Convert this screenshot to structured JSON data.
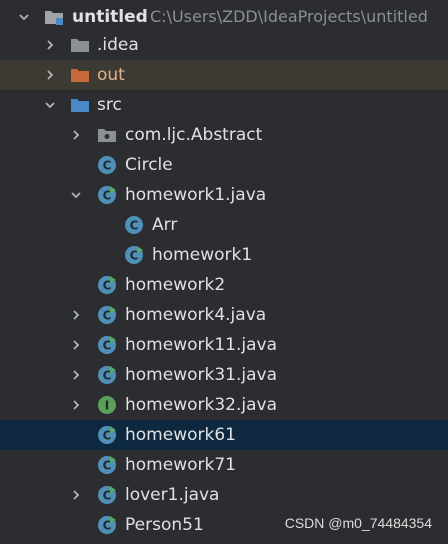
{
  "project": {
    "name": "untitled",
    "path": "C:\\Users\\ZDD\\IdeaProjects\\untitled"
  },
  "items": [
    {
      "label": ".idea",
      "icon": "folder-icon"
    },
    {
      "label": "out",
      "icon": "folder-orange-icon"
    },
    {
      "label": "src",
      "icon": "folder-blue-icon"
    },
    {
      "label": "com.ljc.Abstract",
      "icon": "package-icon"
    },
    {
      "label": "Circle",
      "icon": "class-icon"
    },
    {
      "label": "homework1.java",
      "icon": "class-runnable-icon"
    },
    {
      "label": "Arr",
      "icon": "class-icon"
    },
    {
      "label": "homework1",
      "icon": "class-runnable-icon"
    },
    {
      "label": "homework2",
      "icon": "class-runnable-icon"
    },
    {
      "label": "homework4.java",
      "icon": "class-runnable-icon"
    },
    {
      "label": "homework11.java",
      "icon": "class-runnable-icon"
    },
    {
      "label": "homework31.java",
      "icon": "class-runnable-icon"
    },
    {
      "label": "homework32.java",
      "icon": "interface-runnable-icon"
    },
    {
      "label": "homework61",
      "icon": "class-runnable-icon"
    },
    {
      "label": "homework71",
      "icon": "class-runnable-icon"
    },
    {
      "label": "lover1.java",
      "icon": "class-runnable-icon"
    },
    {
      "label": "Person51",
      "icon": "class-runnable-icon"
    }
  ],
  "watermark": "CSDN @m0_74484354",
  "colors": {
    "background": "#2b2d30",
    "selection": "#0e293f",
    "hover": "#3d3a33",
    "class_icon": "#4f8fb8",
    "interface_icon": "#5c9e5c",
    "run_badge": "#59a869",
    "out_folder": "#c7673a"
  }
}
